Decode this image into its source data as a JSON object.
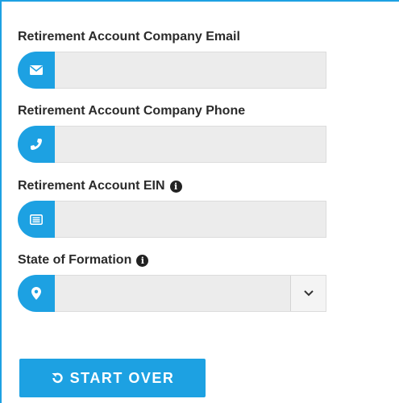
{
  "form": {
    "email": {
      "label": "Retirement Account Company Email",
      "value": "",
      "placeholder": "",
      "icon": "envelope-icon"
    },
    "phone": {
      "label": "Retirement Account Company Phone",
      "value": "",
      "placeholder": "",
      "icon": "phone-icon"
    },
    "ein": {
      "label": "Retirement Account EIN",
      "value": "",
      "placeholder": "",
      "icon": "id-card-icon",
      "info_icon": "info-icon"
    },
    "state": {
      "label": "State of Formation",
      "selected": "",
      "icon": "map-marker-icon",
      "info_icon": "info-icon"
    }
  },
  "actions": {
    "start_over_label": "START OVER",
    "start_over_icon": "undo-icon"
  },
  "colors": {
    "accent": "#1da1e2",
    "field_bg": "#ececec",
    "text": "#2b2b2b"
  }
}
